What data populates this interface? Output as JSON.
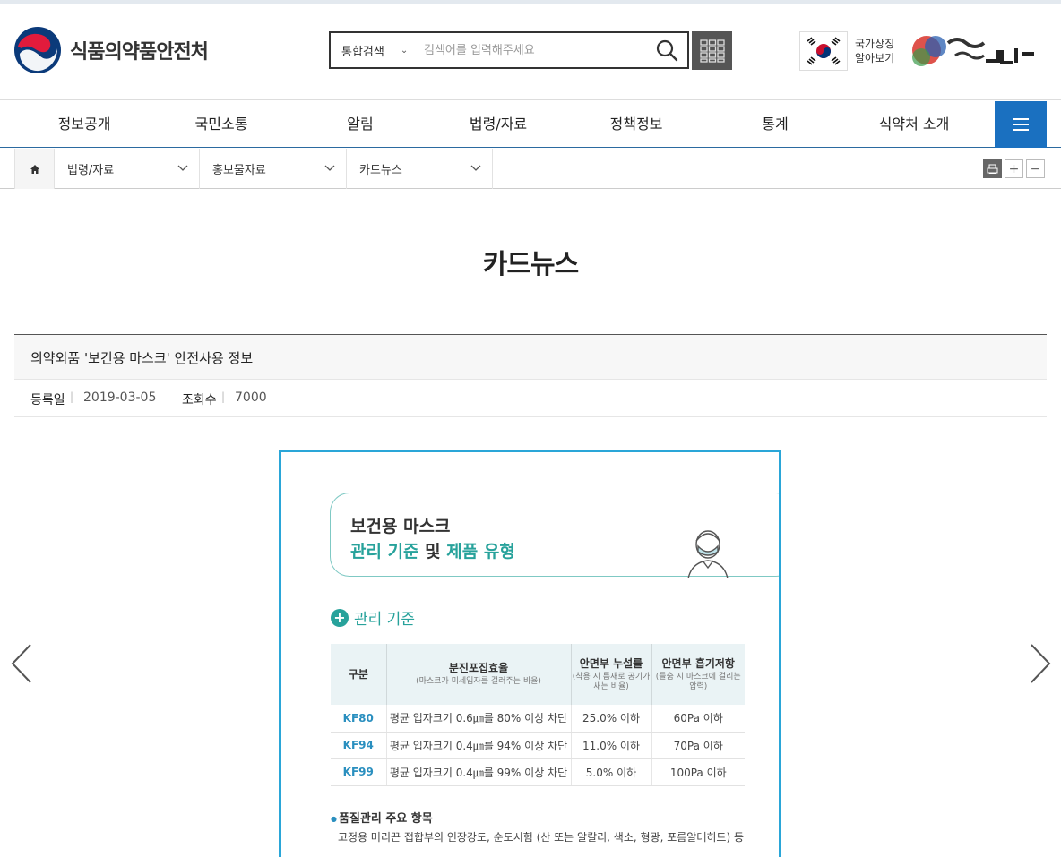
{
  "header": {
    "logo_text": "식품의약품안전처",
    "search": {
      "scope": "통합검색",
      "placeholder": "검색어를 입력해주세요"
    },
    "national_symbol": {
      "line1": "국가상징",
      "line2": "알아보기"
    }
  },
  "gnb": {
    "items": [
      "정보공개",
      "국민소통",
      "알림",
      "법령/자료",
      "정책정보",
      "통계",
      "식약처 소개"
    ]
  },
  "location": {
    "items": [
      "법령/자료",
      "홍보물자료",
      "카드뉴스"
    ]
  },
  "page": {
    "title": "카드뉴스"
  },
  "post": {
    "title": "의약외품 '보건용 마스크' 안전사용 정보",
    "date_label": "등록일",
    "date": "2019-03-05",
    "views_label": "조회수",
    "views": "7000"
  },
  "card": {
    "head_line1": "보건용 마스크",
    "head_line2_a": "관리 기준",
    "head_line2_b": " 및 ",
    "head_line2_c": "제품 유형",
    "section_title": "관리 기준",
    "table": {
      "headers": [
        {
          "title": "구분",
          "sub": ""
        },
        {
          "title": "분진포집효율",
          "sub": "(마스크가 미세입자를 걸러주는 비율)"
        },
        {
          "title": "안면부 누설률",
          "sub": "(착용 시 틈새로 공기가 새는 비율)"
        },
        {
          "title": "안면부 흡기저항",
          "sub": "(들숨 시 마스크에 걸리는 압력)"
        }
      ],
      "rows": [
        {
          "grade": "KF80",
          "efficiency": "평균 입자크기 0.6㎛를 80% 이상 차단",
          "leak": "25.0% 이하",
          "resistance": "60Pa 이하"
        },
        {
          "grade": "KF94",
          "efficiency": "평균 입자크기 0.4㎛를 94% 이상 차단",
          "leak": "11.0% 이하",
          "resistance": "70Pa 이하"
        },
        {
          "grade": "KF99",
          "efficiency": "평균 입자크기 0.4㎛를 99% 이상 차단",
          "leak": "5.0% 이하",
          "resistance": "100Pa 이하"
        }
      ]
    },
    "qc_title": "품질관리 주요 항목",
    "qc_text": "고정용 머리끈 접합부의 인장강도, 순도시험 (산 또는 알칼리, 색소, 형광, 포름알데히드) 등"
  },
  "colors": {
    "accent_blue": "#1a70c0",
    "card_border": "#2aa6d8",
    "teal": "#27a29b"
  }
}
